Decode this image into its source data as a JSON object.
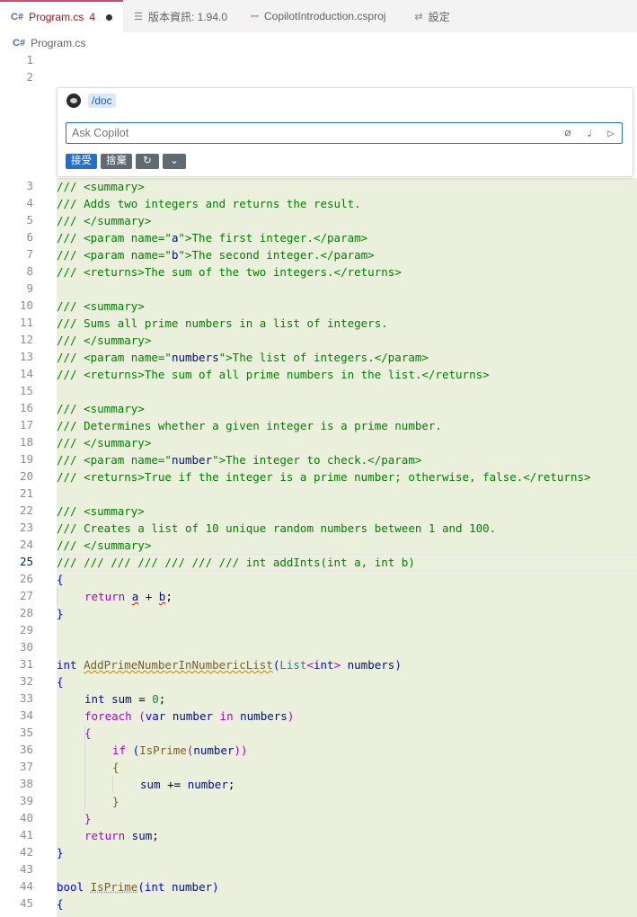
{
  "tabs": [
    {
      "label": "Program.cs",
      "count": "4",
      "modified": true
    },
    {
      "label": "版本資訊: 1.94.0"
    },
    {
      "label": "CopilotIntroduction.csproj"
    },
    {
      "label": "設定"
    }
  ],
  "breadcrumb": {
    "file": "Program.cs"
  },
  "chat": {
    "command": "/doc",
    "placeholder": "Ask Copilot",
    "accept_label": "接受",
    "discard_label": "捨棄",
    "rerun_symbol": "↻",
    "more_symbol": "⌄"
  },
  "line_numbers": [
    "1",
    "2",
    "3",
    "4",
    "5",
    "6",
    "7",
    "8",
    "9",
    "10",
    "11",
    "12",
    "13",
    "14",
    "15",
    "16",
    "17",
    "18",
    "19",
    "20",
    "21",
    "22",
    "23",
    "24",
    "25",
    "26",
    "27",
    "28",
    "29",
    "30",
    "31",
    "32",
    "33",
    "34",
    "35",
    "36",
    "37",
    "38",
    "39",
    "40",
    "41",
    "42",
    "43",
    "44",
    "45"
  ],
  "code": {
    "l3": "/// <summary>",
    "l4": "/// Adds two integers and returns the result.",
    "l5": "/// </summary>",
    "l6a": "/// <param name=\"",
    "l6b": "a",
    "l6c": "\">The first integer.</param>",
    "l7a": "/// <param name=\"",
    "l7b": "b",
    "l7c": "\">The second integer.</param>",
    "l8": "/// <returns>The sum of the two integers.</returns>",
    "l10": "/// <summary>",
    "l11": "/// Sums all prime numbers in a list of integers.",
    "l12": "/// </summary>",
    "l13a": "/// <param name=\"",
    "l13b": "numbers",
    "l13c": "\">The list of integers.</param>",
    "l14": "/// <returns>The sum of all prime numbers in the list.</returns>",
    "l16": "/// <summary>",
    "l17": "/// Determines whether a given integer is a prime number.",
    "l18": "/// </summary>",
    "l19a": "/// <param name=\"",
    "l19b": "number",
    "l19c": "\">The integer to check.</param>",
    "l20": "/// <returns>True if the integer is a prime number; otherwise, false.</returns>",
    "l22": "/// <summary>",
    "l23": "/// Creates a list of 10 unique random numbers between 1 and 100.",
    "l24": "/// </summary>",
    "l25": "/// /// /// /// /// /// /// int addInts(int a, int b)",
    "l26": "{",
    "l27_kw": "return",
    "l27_a": "a",
    "l27_op": " + ",
    "l27_b": "b",
    "l27_end": ";",
    "l28": "}",
    "l31_kw": "int",
    "l31_fn": "AddPrimeNumberInNumbericList",
    "l31_p1": "(",
    "l31_ty": "List",
    "l31_lt": "<",
    "l31_int": "int",
    "l31_gt": ">",
    "l31_var": " numbers",
    "l31_p2": ")",
    "l32": "{",
    "l33_kw": "int",
    "l33_var": " sum",
    "l33_op": " = ",
    "l33_num": "0",
    "l33_end": ";",
    "l34_kw": "foreach",
    "l34_p1": " (",
    "l34_var1": "var",
    "l34_var2": " number",
    "l34_in": " in",
    "l34_var3": " numbers",
    "l34_p2": ")",
    "l35": "{",
    "l36_kw": "if",
    "l36_p1": " (",
    "l36_fn": "IsPrime",
    "l36_p2": "(",
    "l36_var": "number",
    "l36_p3": "))",
    "l37": "{",
    "l38_var": "sum",
    "l38_op": " += ",
    "l38_var2": "number",
    "l38_end": ";",
    "l39": "}",
    "l40": "}",
    "l41_kw": "return",
    "l41_var": " sum",
    "l41_end": ";",
    "l42": "}",
    "l44_kw": "bool",
    "l44_fn": "IsPrime",
    "l44_p1": "(",
    "l44_int": "int",
    "l44_var": " number",
    "l44_p2": ")",
    "l45": "{"
  },
  "colors": {
    "comment": "#008000",
    "keyword": "#0000ff",
    "control": "#af00db",
    "type": "#267f99",
    "function": "#795e26",
    "variable": "#001080",
    "string": "#a31515",
    "number": "#098658",
    "highlight": "#eaf0dc",
    "accent": "#1f6fd0"
  }
}
